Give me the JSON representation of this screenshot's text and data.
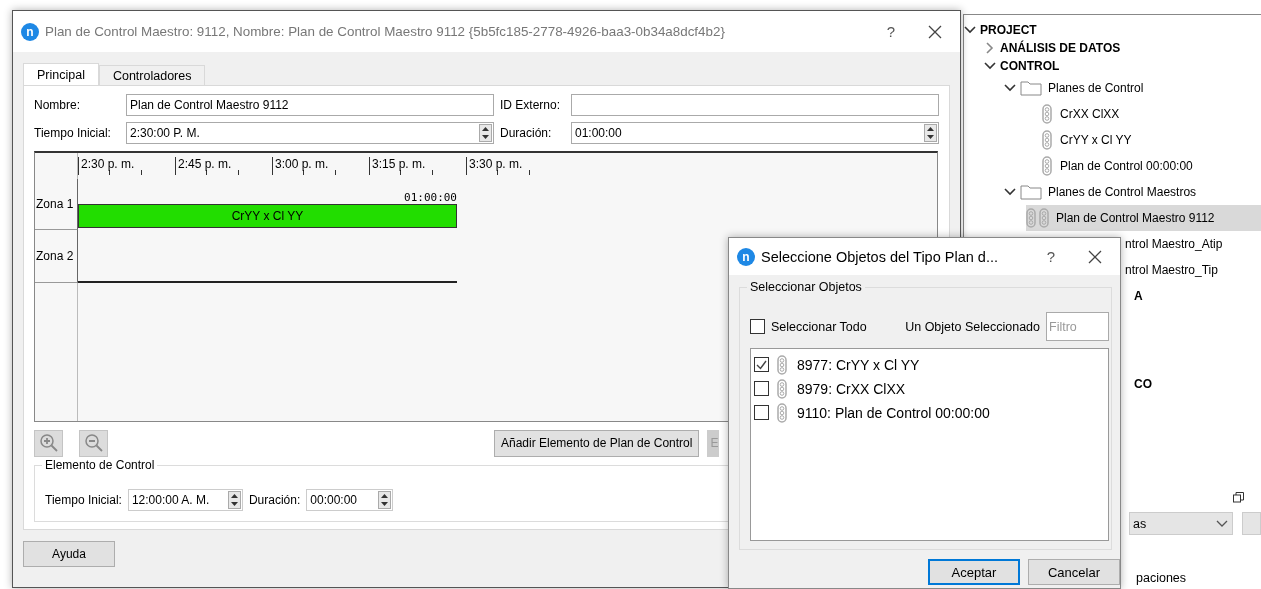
{
  "main_dialog": {
    "app_icon": "n",
    "title": "Plan de Control Maestro: 9112, Nombre: Plan de Control Maestro 9112  {5b5fc185-2778-4926-baa3-0b34a8dcf4b2}",
    "help": "?",
    "tabs": [
      {
        "label": "Principal",
        "selected": true
      },
      {
        "label": "Controladores",
        "selected": false
      }
    ],
    "form": {
      "name_label": "Nombre:",
      "name_value": "Plan de Control Maestro 9112",
      "external_id_label": "ID Externo:",
      "start_label": "Tiempo Inicial:",
      "start_value": "2:30:00 P. M.",
      "duration_label": "Duración:",
      "duration_value": "01:00:00"
    },
    "timeline": {
      "ticks": [
        "2:30 p. m.",
        "2:45 p. m.",
        "3:00 p. m.",
        "3:15 p. m.",
        "3:30 p. m."
      ],
      "zones": [
        {
          "label": "Zona 1",
          "bars": [
            {
              "label": "CrYY x Cl YY",
              "duration": "01:00:00"
            }
          ]
        },
        {
          "label": "Zona 2"
        }
      ]
    },
    "add_button": "Añadir Elemento de Plan de Control",
    "next_button": {
      "label": "E",
      "disabled": true
    },
    "element_group": {
      "title": "Elemento de Control",
      "start_label": "Tiempo Inicial:",
      "start_value": "12:00:00 A. M.",
      "duration_label": "Duración:",
      "duration_value": "00:00:00",
      "disabled": true
    },
    "help_button": "Ayuda"
  },
  "tree_panel": {
    "items": [
      {
        "label": "PROJECT",
        "kind": "section",
        "expanded": true,
        "selected": false,
        "children": [
          {
            "label": "ANÁLISIS DE DATOS",
            "kind": "section",
            "expanded": false,
            "selected": false
          },
          {
            "label": "CONTROL",
            "kind": "section",
            "expanded": true,
            "selected": false,
            "children": [
              {
                "label": "Planes de Control",
                "kind": "folder",
                "expanded": true,
                "selected": false,
                "children": [
                  {
                    "label": "CrXX ClXX",
                    "kind": "plan",
                    "selected": false
                  },
                  {
                    "label": "CrYY x Cl YY",
                    "kind": "plan",
                    "selected": false
                  },
                  {
                    "label": "Plan de Control 00:00:00",
                    "kind": "plan",
                    "selected": false
                  }
                ]
              },
              {
                "label": "Planes de Control Maestros",
                "kind": "folder",
                "expanded": true,
                "selected": false,
                "children": [
                  {
                    "label": "Plan de Control Maestro 9112",
                    "kind": "master_plan",
                    "selected": true
                  },
                  {
                    "label": "ntrol Maestro_Atip",
                    "kind": "fragment",
                    "selected": false
                  },
                  {
                    "label": "ntrol Maestro_Tip",
                    "kind": "fragment",
                    "selected": false
                  }
                ]
              }
            ]
          }
        ]
      },
      {
        "label": "A",
        "kind": "fragment_bold",
        "selected": false
      },
      {
        "label": "CO",
        "kind": "fragment_bold",
        "selected": false
      }
    ],
    "dropdown_value": "as",
    "footer_text": "paciones"
  },
  "select_dialog": {
    "app_icon": "n",
    "title": "Seleccione Objetos del Tipo Plan d...",
    "help": "?",
    "group_title": "Seleccionar Objetos",
    "select_all": {
      "label": "Seleccionar Todo",
      "checked": false
    },
    "count_text": "Un Objeto Seleccionado",
    "filter_placeholder": "Filtro",
    "items": [
      {
        "label": "8977: CrYY x Cl YY",
        "checked": true
      },
      {
        "label": "8979: CrXX ClXX",
        "checked": false
      },
      {
        "label": "9110: Plan de Control 00:00:00",
        "checked": false
      }
    ],
    "buttons": [
      {
        "label": "Aceptar",
        "default": true
      },
      {
        "label": "Cancelar",
        "default": false
      }
    ]
  }
}
